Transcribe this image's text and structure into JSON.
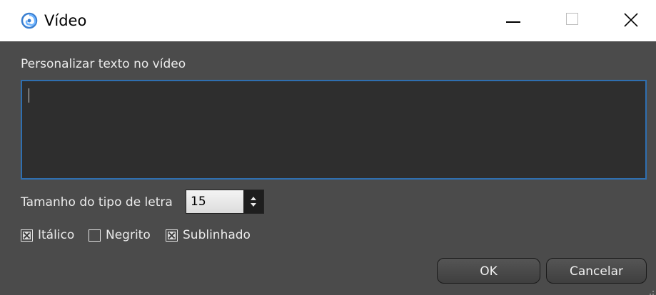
{
  "window": {
    "title": "Vídeo",
    "icon": "swirl-app-icon",
    "controls": {
      "minimize": "minimize-icon",
      "maximize": "maximize-icon",
      "close": "close-icon"
    }
  },
  "form": {
    "text_label": "Personalizar texto no vídeo",
    "text_value": "",
    "font_size_label": "Tamanho do tipo de letra",
    "font_size_value": "15",
    "checkboxes": [
      {
        "label": "Itálico",
        "checked": true
      },
      {
        "label": "Negrito",
        "checked": false
      },
      {
        "label": "Sublinhado",
        "checked": true
      }
    ]
  },
  "buttons": {
    "ok": "OK",
    "cancel": "Cancelar"
  },
  "colors": {
    "accent_border": "#2f6fb0",
    "background": "#4b4b4b",
    "input_bg": "#2e2e2e",
    "app_icon": "#3a7fd0"
  }
}
